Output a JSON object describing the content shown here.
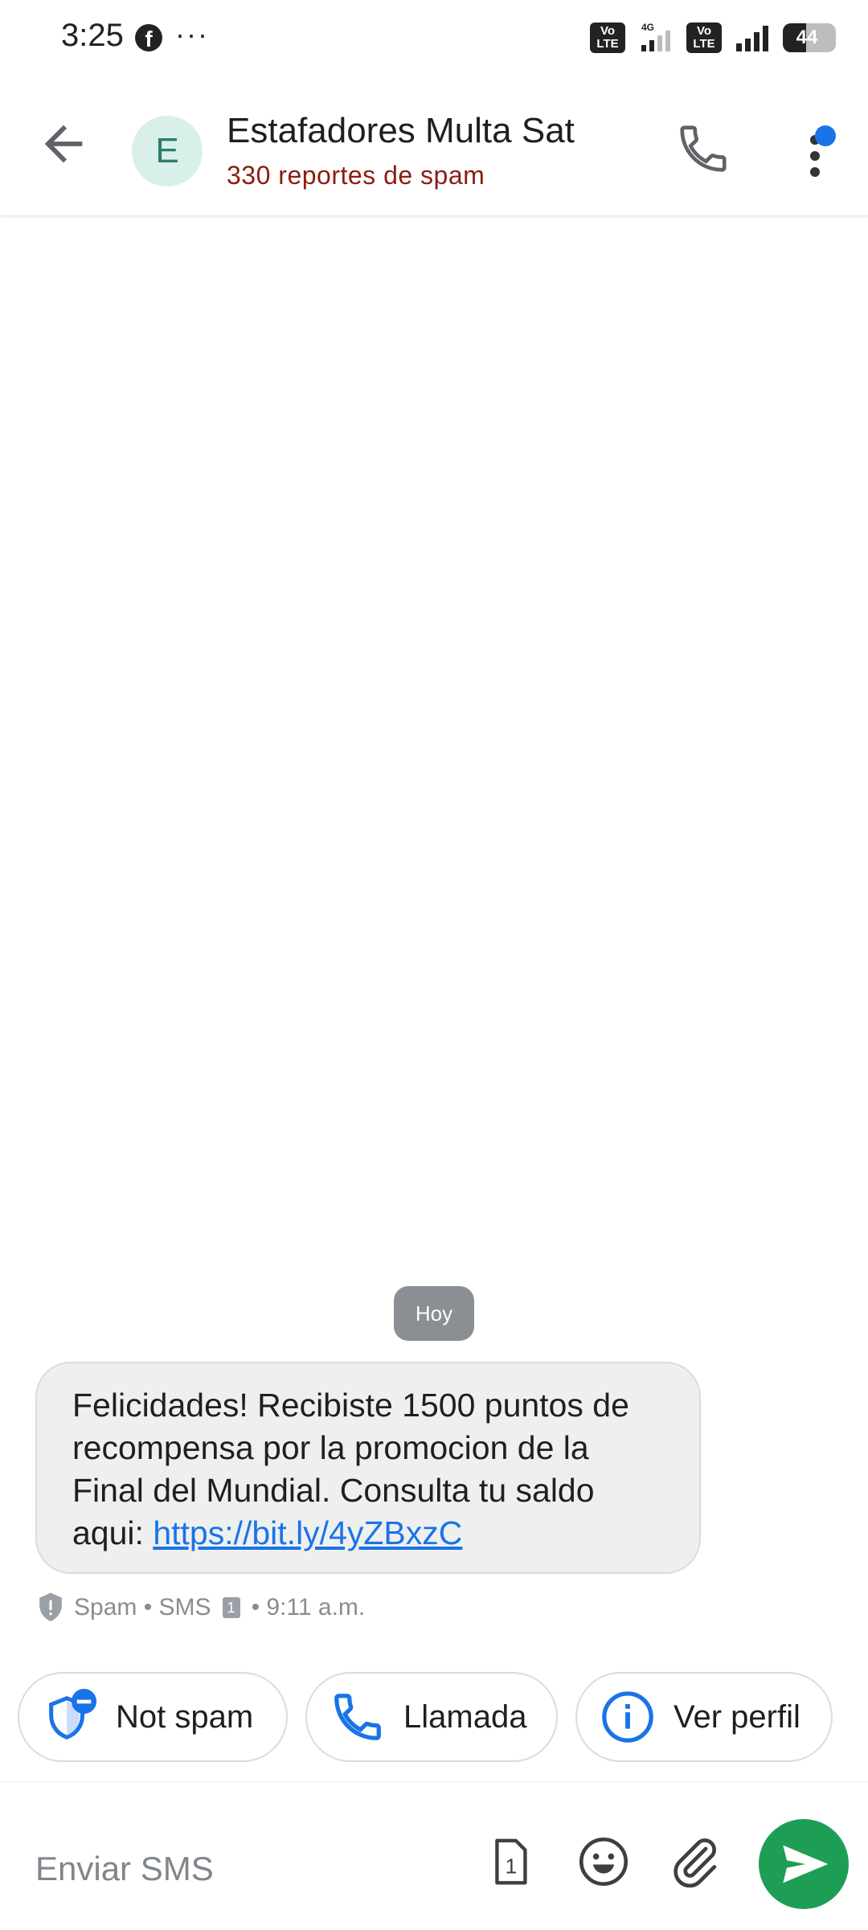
{
  "status_bar": {
    "time": "3:25",
    "left_icons": [
      "facebook-icon",
      "more-icon"
    ],
    "more_label": "···",
    "right_icons": [
      "volte-icon",
      "signal-4g-icon",
      "volte-icon",
      "signal-icon",
      "battery-icon"
    ],
    "volte_label": "Vo LTE",
    "net_label": "4G",
    "battery_level": "44"
  },
  "header": {
    "avatar_letter": "E",
    "title": "Estafadores Multa Sat",
    "subtitle": "330 reportes de spam"
  },
  "conversation": {
    "date_label": "Hoy",
    "message": {
      "text": "Felicidades! Recibiste 1500 puntos de recompensa por la promocion de la Final del Mundial. Consulta tu saldo aqui: ",
      "link": "https://bit.ly/4yZBxzC"
    },
    "meta": {
      "label": "Spam • SMS",
      "sim": "1",
      "time": "• 9:11 a.m."
    }
  },
  "suggestions": [
    {
      "label": "Not spam",
      "icon": "shield-minus-icon"
    },
    {
      "label": "Llamada",
      "icon": "phone-icon"
    },
    {
      "label": "Ver perfil",
      "icon": "info-icon"
    }
  ],
  "composer": {
    "placeholder": "Enviar SMS",
    "sim": "1"
  },
  "colors": {
    "accent": "#1a73e8",
    "spam_red": "#8b1d12",
    "send_green": "#1e9e55",
    "bubble_bg": "#eef0ef"
  }
}
